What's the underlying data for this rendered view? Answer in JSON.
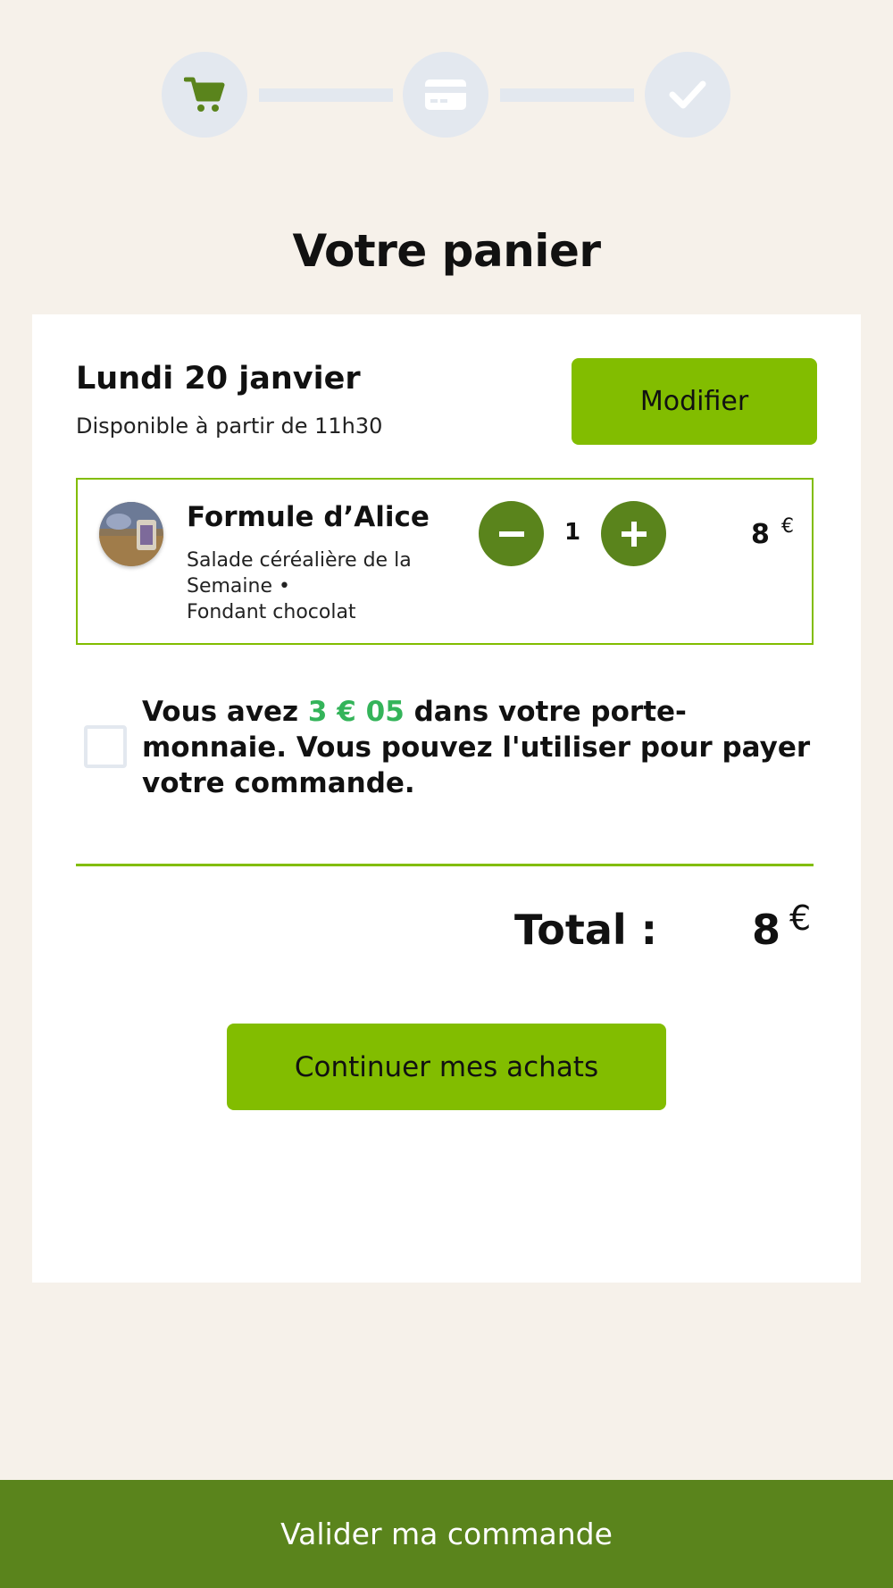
{
  "steps": [
    {
      "icon": "cart-icon",
      "state": "active",
      "color": "#5a841c"
    },
    {
      "icon": "credit-card-icon",
      "state": "inactive",
      "color": "#ffffff"
    },
    {
      "icon": "check-icon",
      "state": "inactive",
      "color": "#ffffff"
    }
  ],
  "title": "Votre panier",
  "delivery": {
    "date": "Lundi 20 janvier",
    "availability": "Disponible à partir de 11h30",
    "modify_label": "Modifier"
  },
  "cart": {
    "items": [
      {
        "name": "Formule d’Alice",
        "description_lines": [
          "Salade céréalière de la",
          "Semaine •",
          "Fondant chocolat"
        ],
        "quantity": "1",
        "price": "8",
        "currency": "€"
      }
    ]
  },
  "wallet": {
    "checked": false,
    "text_before": "Vous avez ",
    "amount": "3 € 05",
    "text_after": " dans votre porte-monnaie. Vous pouvez l'utiliser pour payer votre commande."
  },
  "total": {
    "label": "Total :",
    "value": "8",
    "currency": "€"
  },
  "continue_label": "Continuer mes achats",
  "submit_label": "Valider ma commande",
  "colors": {
    "accent": "#82bd00",
    "dark_green": "#5a841c",
    "wallet_amount": "#34b45a",
    "background": "#f6f1ea",
    "step_inactive": "#e3e8ef"
  }
}
